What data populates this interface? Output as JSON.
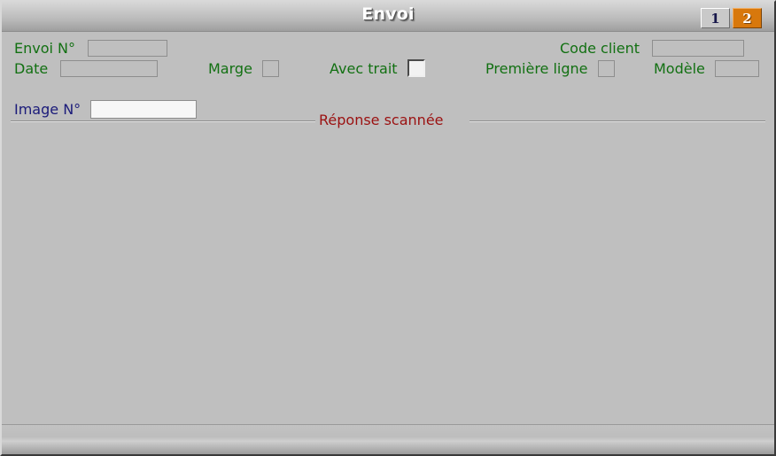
{
  "window": {
    "title": "Envoi"
  },
  "tabs": [
    {
      "label": "1",
      "state": "inactive"
    },
    {
      "label": "2",
      "state": "active"
    }
  ],
  "form": {
    "envoi_numero": {
      "label": "Envoi N°",
      "value": "",
      "state": "disabled"
    },
    "date": {
      "label": "Date",
      "value": "",
      "state": "disabled"
    },
    "marge": {
      "label": "Marge",
      "checked": false,
      "state": "disabled"
    },
    "avec_trait": {
      "label": "Avec trait",
      "checked": false,
      "state": "enabled"
    },
    "code_client": {
      "label": "Code client",
      "value": "",
      "state": "disabled"
    },
    "premiere_ligne": {
      "label": "Première ligne",
      "checked": false,
      "state": "disabled"
    },
    "modele": {
      "label": "Modèle",
      "value": "",
      "state": "disabled"
    }
  },
  "group": {
    "caption": "Réponse scannée",
    "image_numero": {
      "label": "Image N°",
      "value": "",
      "state": "active"
    }
  },
  "statusbar": {
    "message": ""
  },
  "colors": {
    "label_enabled": "#1b1b7a",
    "label_disabled": "#127012",
    "group_caption": "#9b1111",
    "tab_active_bg": "#d8780c",
    "window_bg": "#bfbfbf"
  }
}
